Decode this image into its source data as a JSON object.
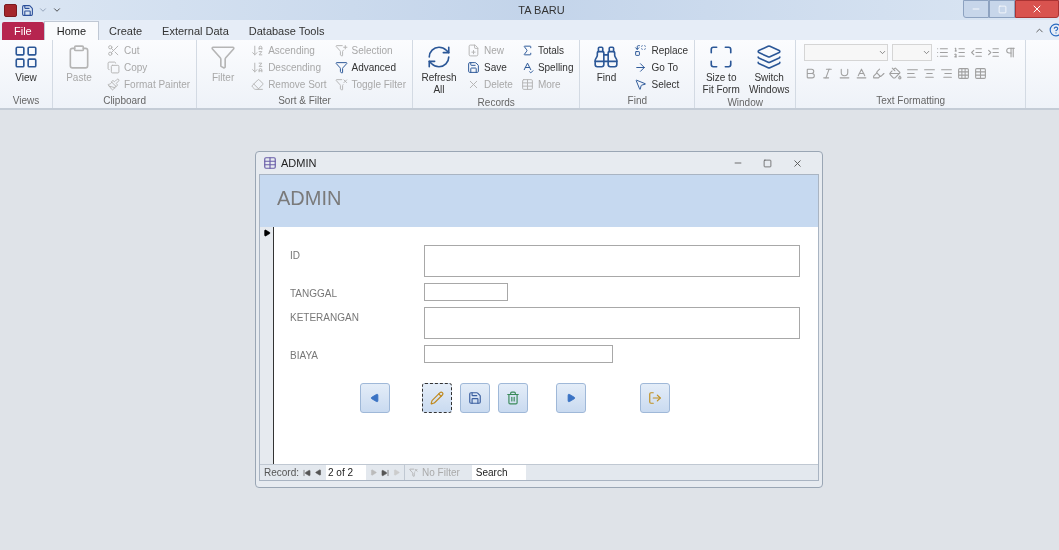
{
  "window": {
    "title": "TA BARU"
  },
  "tabs": [
    {
      "label": "File",
      "kind": "file",
      "selected": false
    },
    {
      "label": "Home",
      "kind": "tab",
      "selected": true
    },
    {
      "label": "Create",
      "kind": "tab",
      "selected": false
    },
    {
      "label": "External Data",
      "kind": "tab",
      "selected": false
    },
    {
      "label": "Database Tools",
      "kind": "tab",
      "selected": false
    }
  ],
  "ribbon": [
    {
      "label": "Views",
      "columns": [
        [
          {
            "kind": "large",
            "label": "View",
            "disabled": false
          }
        ]
      ]
    },
    {
      "label": "Clipboard",
      "columns": [
        [
          {
            "kind": "large",
            "label": "Paste",
            "disabled": true
          }
        ],
        [
          {
            "kind": "small",
            "label": "Cut",
            "disabled": true
          },
          {
            "kind": "small",
            "label": "Copy",
            "disabled": true
          },
          {
            "kind": "small",
            "label": "Format Painter",
            "disabled": true
          }
        ]
      ]
    },
    {
      "label": "Sort & Filter",
      "columns": [
        [
          {
            "kind": "large",
            "label": "Filter",
            "disabled": true
          }
        ],
        [
          {
            "kind": "small",
            "label": "Ascending",
            "disabled": true
          },
          {
            "kind": "small",
            "label": "Descending",
            "disabled": true
          },
          {
            "kind": "small",
            "label": "Remove Sort",
            "disabled": true
          }
        ],
        [
          {
            "kind": "small",
            "label": "Selection",
            "disabled": true
          },
          {
            "kind": "small",
            "label": "Advanced",
            "disabled": false
          },
          {
            "kind": "small",
            "label": "Toggle Filter",
            "disabled": true
          }
        ]
      ]
    },
    {
      "label": "Records",
      "columns": [
        [
          {
            "kind": "large",
            "label": "Refresh All",
            "disabled": false
          }
        ],
        [
          {
            "kind": "small",
            "label": "New",
            "disabled": true
          },
          {
            "kind": "small",
            "label": "Save",
            "disabled": false
          },
          {
            "kind": "small",
            "label": "Delete",
            "disabled": true
          }
        ],
        [
          {
            "kind": "small",
            "label": "Totals",
            "disabled": false
          },
          {
            "kind": "small",
            "label": "Spelling",
            "disabled": false
          },
          {
            "kind": "small",
            "label": "More",
            "disabled": true
          }
        ]
      ]
    },
    {
      "label": "Find",
      "columns": [
        [
          {
            "kind": "large",
            "label": "Find",
            "disabled": false
          }
        ],
        [
          {
            "kind": "small",
            "label": "Replace",
            "disabled": false
          },
          {
            "kind": "small",
            "label": "Go To",
            "disabled": false
          },
          {
            "kind": "small",
            "label": "Select",
            "disabled": false
          }
        ]
      ]
    },
    {
      "label": "Window",
      "columns": [
        [
          {
            "kind": "large",
            "label": "Size to Fit Form",
            "disabled": false
          }
        ],
        [
          {
            "kind": "large",
            "label": "Switch Windows",
            "disabled": false
          }
        ]
      ]
    },
    {
      "label": "Text Formatting",
      "kind": "formatting"
    }
  ],
  "form": {
    "title": "ADMIN",
    "header": "ADMIN",
    "fields": [
      {
        "label": "ID",
        "kind": "tall"
      },
      {
        "label": "TANGGAL",
        "kind": "short"
      },
      {
        "label": "KETERANGAN",
        "kind": "tall"
      },
      {
        "label": "BIAYA",
        "kind": "medium"
      }
    ],
    "buttons": [
      {
        "kind": "previous",
        "focused": false
      },
      {
        "kind": "edit",
        "focused": true
      },
      {
        "kind": "save",
        "focused": false
      },
      {
        "kind": "delete",
        "focused": false
      },
      {
        "kind": "next",
        "focused": false
      },
      {
        "kind": "exit",
        "focused": false
      }
    ],
    "navigation": {
      "label": "Record:",
      "position": "2 of 2",
      "filter": "No Filter",
      "search": "Search"
    }
  }
}
